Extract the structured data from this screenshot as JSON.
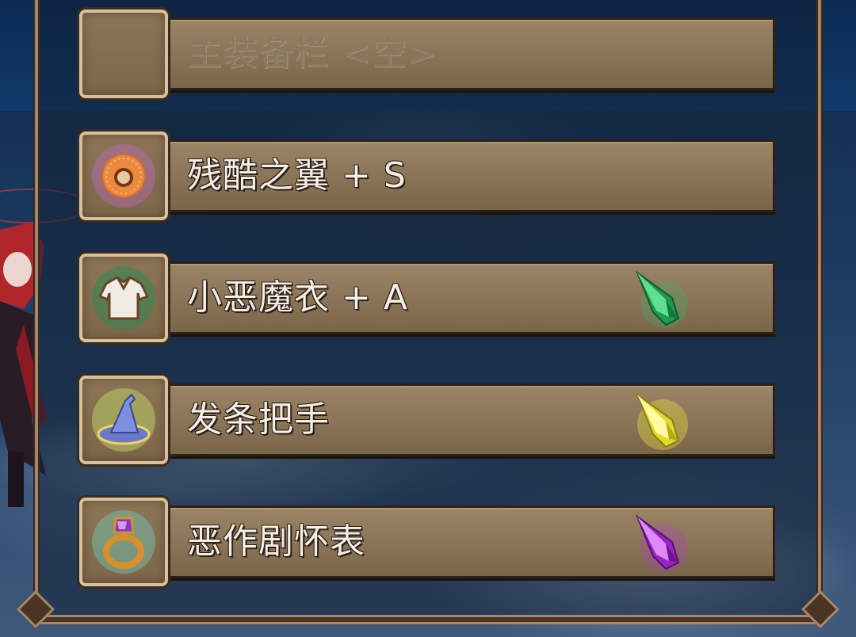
{
  "slots": [
    {
      "label": "主装备栏 <空>",
      "empty": true,
      "icon": "empty-slot",
      "gem": null
    },
    {
      "label": "残酷之翼 + S",
      "empty": false,
      "icon": "donut-icon",
      "gem": null
    },
    {
      "label": "小恶魔衣 + A",
      "empty": false,
      "icon": "shirt-icon",
      "gem": "green-gem-icon"
    },
    {
      "label": "发条把手",
      "empty": false,
      "icon": "wizard-hat-icon",
      "gem": "yellow-gem-icon"
    },
    {
      "label": "恶作剧怀表",
      "empty": false,
      "icon": "ring-icon",
      "gem": "purple-gem-icon"
    }
  ],
  "colors": {
    "green_gem": "#2fbf6a",
    "yellow_gem": "#f3ec3a",
    "purple_gem": "#b235e0",
    "bar": "#8a7457",
    "frame": "#a88566"
  }
}
